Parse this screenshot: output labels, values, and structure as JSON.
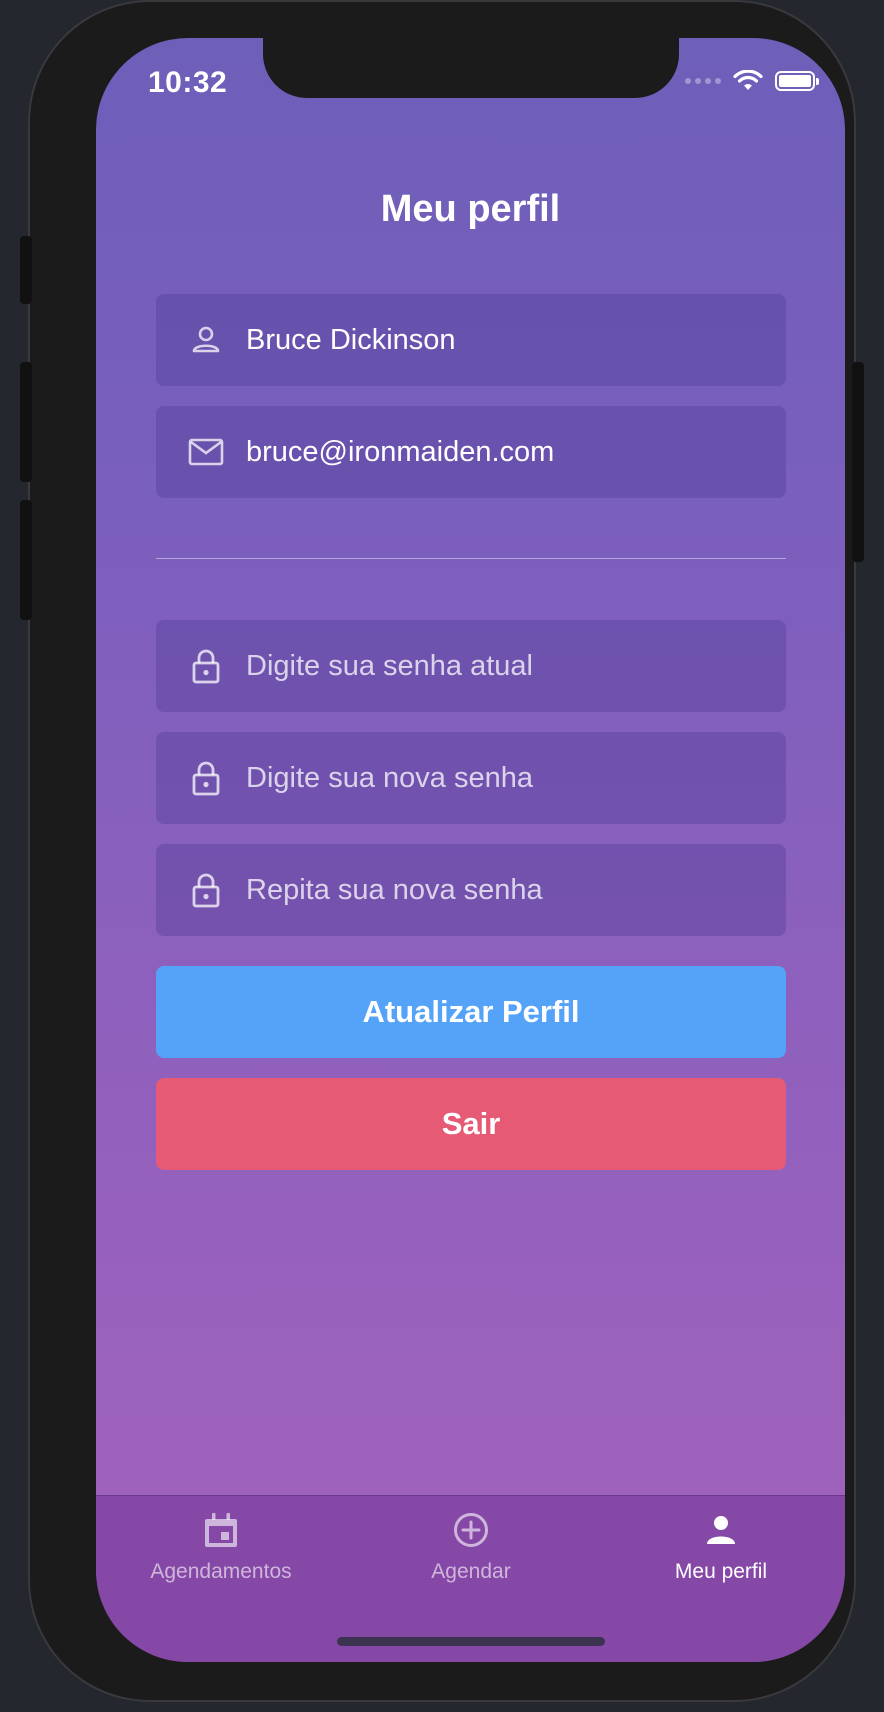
{
  "status_bar": {
    "time": "10:32"
  },
  "header": {
    "title": "Meu perfil"
  },
  "profile": {
    "name": "Bruce Dickinson",
    "email": "bruce@ironmaiden.com"
  },
  "password": {
    "current_placeholder": "Digite sua senha atual",
    "new_placeholder": "Digite sua nova senha",
    "confirm_placeholder": "Repita sua nova senha"
  },
  "actions": {
    "update_label": "Atualizar Perfil",
    "exit_label": "Sair"
  },
  "tabbar": {
    "items": [
      {
        "label": "Agendamentos",
        "icon": "calendar-icon",
        "active": false
      },
      {
        "label": "Agendar",
        "icon": "add-circle-icon",
        "active": false
      },
      {
        "label": "Meu perfil",
        "icon": "person-icon",
        "active": true
      }
    ]
  },
  "colors": {
    "update_button": "#55a2f9",
    "exit_button": "#e65a75",
    "tabbar_bg": "#8548a6"
  }
}
